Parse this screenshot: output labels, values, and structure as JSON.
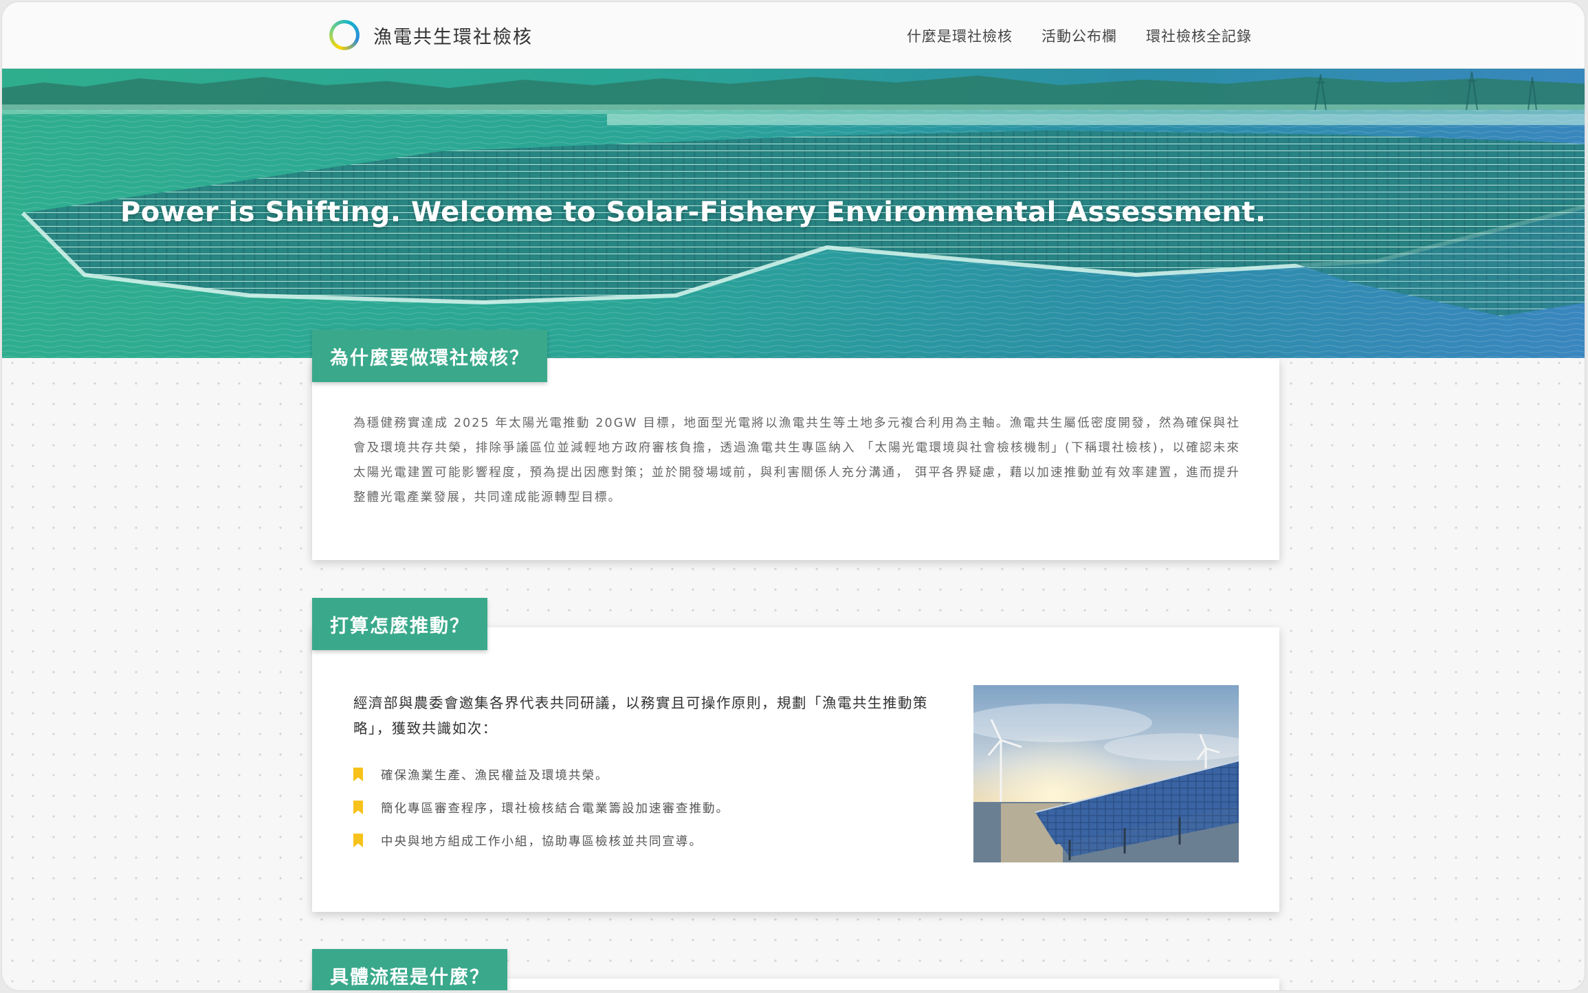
{
  "nav": {
    "brand": "漁電共生環社檢核",
    "menu": [
      "什麼是環社檢核",
      "活動公布欄",
      "環社檢核全記錄"
    ]
  },
  "hero": {
    "title": "Power is Shifting. Welcome to Solar-Fishery Environmental Assessment."
  },
  "sections": {
    "why": {
      "heading": "為什麼要做環社檢核？",
      "body": "為穩健務實達成 2025 年太陽光電推動 20GW 目標，地面型光電將以漁電共生等土地多元複合利用為主軸。漁電共生屬低密度開發，然為確保與社會及環境共存共榮，排除爭議區位並減輕地方政府審核負擔，透過漁電共生專區納入 「太陽光電環境與社會檢核機制」(下稱環社檢核)，以確認未來太陽光電建置可能影響程度，預為提出因應對策；並於開發場域前，與利害關係人充分溝通， 弭平各界疑慮，藉以加速推動並有效率建置，進而提升整體光電產業發展，共同達成能源轉型目標。"
    },
    "how": {
      "heading": "打算怎麼推動？",
      "lead": "經濟部與農委會邀集各界代表共同研議，以務實且可操作原則，規劃「漁電共生推動策略」，獲致共識如次：",
      "points": [
        "確保漁業生產、漁民權益及環境共榮。",
        "簡化專區審查程序，環社檢核結合電業籌設加速審查推動。",
        "中央與地方組成工作小組，協助專區檢核並共同宣導。"
      ]
    },
    "process": {
      "heading": "具體流程是什麼？"
    }
  },
  "colors": {
    "accent": "#3aa98b",
    "bookmark": "#f7c21b"
  }
}
